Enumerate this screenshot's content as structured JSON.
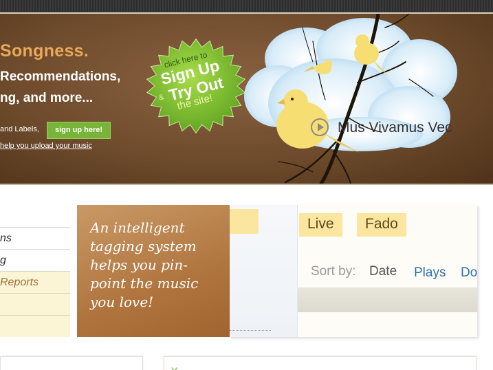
{
  "hero": {
    "brand": "Songness.",
    "tagline_1": "Recommendations,",
    "tagline_2": "ng, and more...",
    "artists_text": "and Labels,",
    "signup_button": "sign up here!",
    "upload_link": "help you upload your music"
  },
  "badge": {
    "line1": "click here to",
    "line2": "Sign Up",
    "amp": "&",
    "line3": "Try Out",
    "line4": "the site!",
    "color": "#7cc12e"
  },
  "left_list": {
    "items": [
      {
        "label": "ns",
        "highlighted": false
      },
      {
        "label": "g",
        "highlighted": false
      },
      {
        "label": "Reports",
        "highlighted": true
      },
      {
        "label": "",
        "highlighted": true
      },
      {
        "label": "",
        "highlighted": true
      }
    ]
  },
  "feature": {
    "text": "An intelligent tagging system helps you pin-point the music you love!"
  },
  "screenshot": {
    "tags": [
      "Live",
      "Fado"
    ],
    "sort_label": "Sort by:",
    "sort_options": [
      "Date",
      "Plays",
      "Do"
    ],
    "song_title": "Mus Vivamus Vec"
  },
  "bottom": {
    "right_text": "Y"
  },
  "colors": {
    "hero_brown": "#6e4b2c",
    "brand_orange": "#e9a85a",
    "signup_green": "#79b43a",
    "feature_brown": "#b0753f",
    "highlight_yellow": "#fbf5d6",
    "link_blue": "#2d6fb3"
  }
}
